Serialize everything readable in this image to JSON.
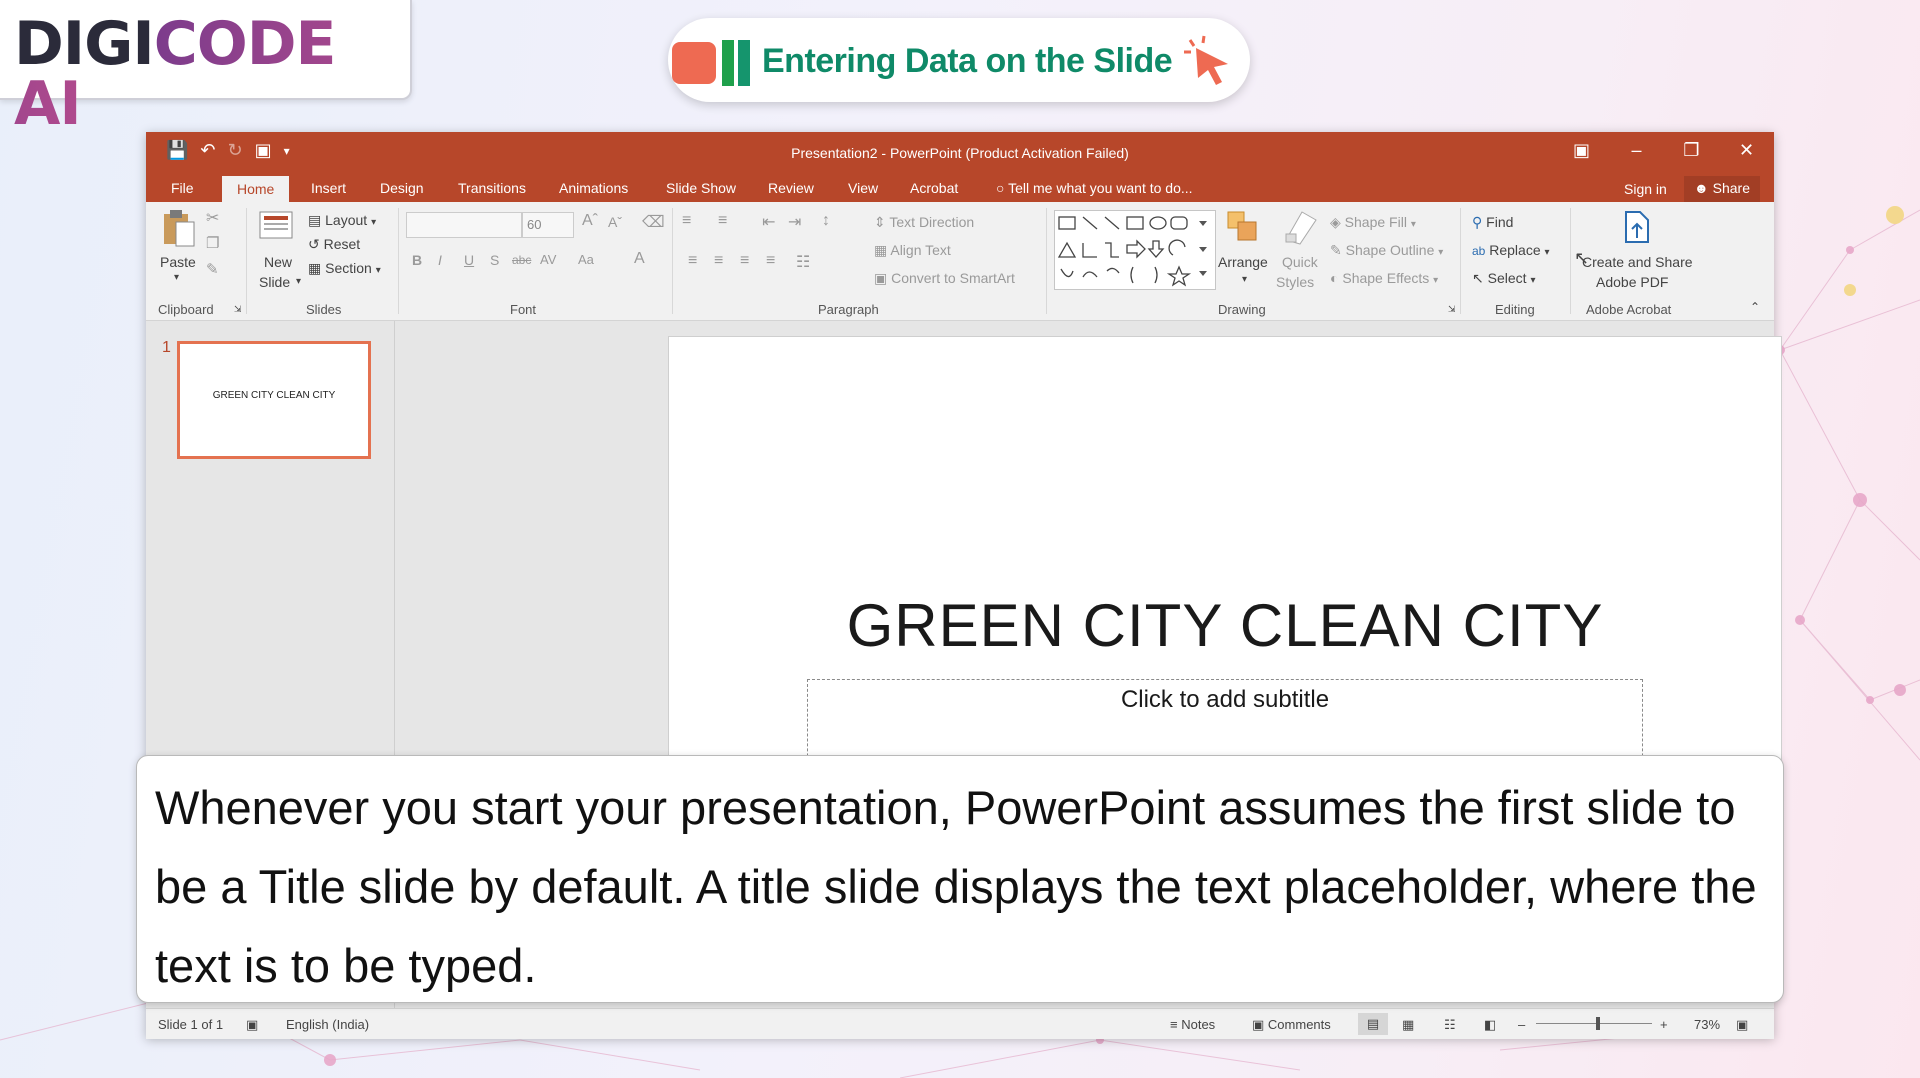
{
  "brand": {
    "logo_part1": "DIGI",
    "logo_part2": "CODE AI"
  },
  "lesson": {
    "title": "Entering Data on the Slide"
  },
  "app": {
    "window_title": "Presentation2 - PowerPoint (Product Activation Failed)",
    "accent_color": "#b7472a",
    "tabs": [
      "File",
      "Home",
      "Insert",
      "Design",
      "Transitions",
      "Animations",
      "Slide Show",
      "Review",
      "View",
      "Acrobat"
    ],
    "active_tab": "Home",
    "tell_me_placeholder": "Tell me what you want to do...",
    "sign_in": "Sign in",
    "share": "Share"
  },
  "ribbon": {
    "clipboard": {
      "paste": "Paste",
      "label": "Clipboard"
    },
    "slides": {
      "new_slide_1": "New",
      "new_slide_2": "Slide",
      "layout": "Layout",
      "reset": "Reset",
      "section": "Section",
      "label": "Slides"
    },
    "font": {
      "font_size": "60",
      "label": "Font"
    },
    "paragraph": {
      "text_direction": "Text Direction",
      "align_text": "Align Text",
      "convert_smartart": "Convert to SmartArt",
      "label": "Paragraph"
    },
    "drawing": {
      "arrange": "Arrange",
      "quick_1": "Quick",
      "quick_2": "Styles",
      "shape_fill": "Shape Fill",
      "shape_outline": "Shape Outline",
      "shape_effects": "Shape Effects",
      "label": "Drawing"
    },
    "editing": {
      "find": "Find",
      "replace": "Replace",
      "select": "Select",
      "label": "Editing"
    },
    "acrobat": {
      "create_1": "Create and Share",
      "create_2": "Adobe PDF",
      "label": "Adobe Acrobat"
    }
  },
  "thumbnails": [
    {
      "number": "1",
      "text": "GREEN CITY CLEAN CITY"
    }
  ],
  "slide": {
    "title": "GREEN CITY CLEAN CITY",
    "subtitle_placeholder": "Click to add subtitle"
  },
  "status": {
    "slide_info": "Slide 1 of 1",
    "language": "English (India)",
    "notes": "Notes",
    "comments": "Comments",
    "zoom": "73%"
  },
  "caption": {
    "text": "Whenever you start your presentation, PowerPoint assumes the first slide to be a Title slide by default. A title slide displays the text placeholder, where the text is to be typed."
  }
}
